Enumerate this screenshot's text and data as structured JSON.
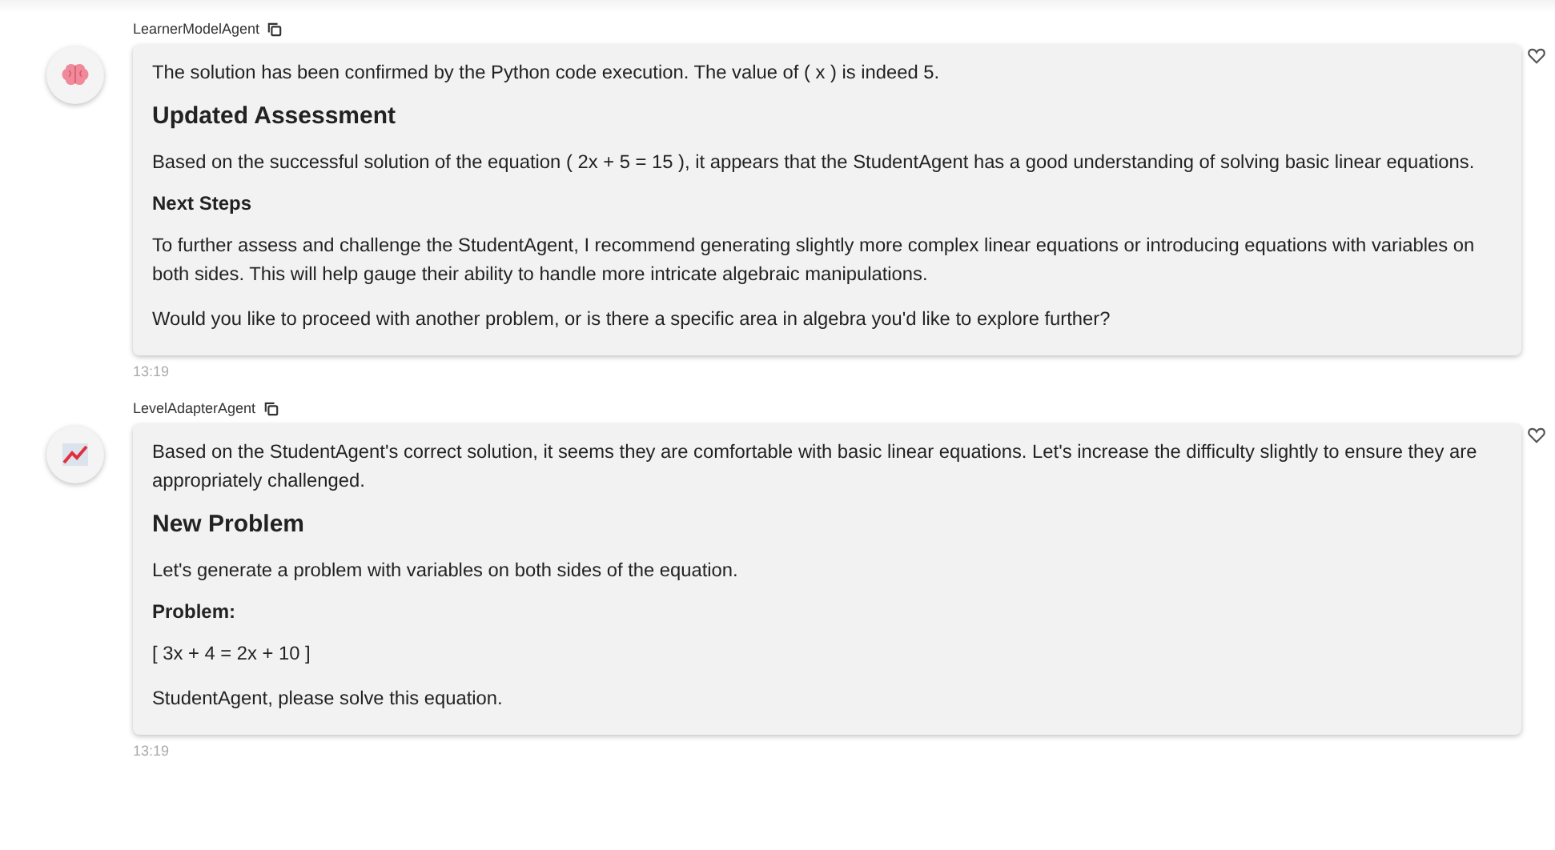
{
  "messages": [
    {
      "sender": "LearnerModelAgent",
      "kind": "brain",
      "time": "13:19",
      "blocks": [
        {
          "kind": "paragraph",
          "text": "The solution has been confirmed by the Python code execution. The value of ( x ) is indeed 5."
        },
        {
          "kind": "heading",
          "text": "Updated Assessment"
        },
        {
          "kind": "paragraph",
          "text": "Based on the successful solution of the equation ( 2x + 5 = 15 ), it appears that the StudentAgent has a good understanding of solving basic linear equations."
        },
        {
          "kind": "subheading",
          "text": "Next Steps"
        },
        {
          "kind": "paragraph",
          "text": "To further assess and challenge the StudentAgent, I recommend generating slightly more complex linear equations or introducing equations with variables on both sides. This will help gauge their ability to handle more intricate algebraic manipulations."
        },
        {
          "kind": "paragraph",
          "text": "Would you like to proceed with another problem, or is there a specific area in algebra you'd like to explore further?"
        }
      ]
    },
    {
      "sender": "LevelAdapterAgent",
      "kind": "chart",
      "time": "13:19",
      "blocks": [
        {
          "kind": "paragraph",
          "text": "Based on the StudentAgent's correct solution, it seems they are comfortable with basic linear equations. Let's increase the difficulty slightly to ensure they are appropriately challenged."
        },
        {
          "kind": "heading",
          "text": "New Problem"
        },
        {
          "kind": "paragraph",
          "text": "Let's generate a problem with variables on both sides of the equation."
        },
        {
          "kind": "subheading",
          "text": "Problem:"
        },
        {
          "kind": "paragraph",
          "text": "[ 3x + 4 = 2x + 10 ]"
        },
        {
          "kind": "paragraph",
          "text": "StudentAgent, please solve this equation."
        }
      ]
    }
  ]
}
